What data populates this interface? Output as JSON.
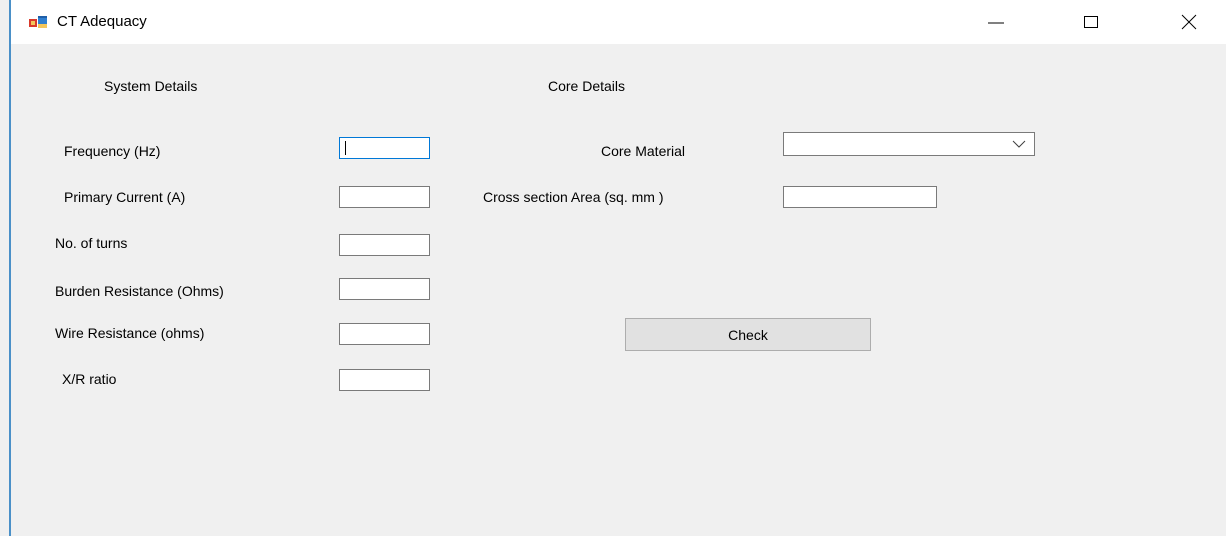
{
  "window": {
    "title": "CT Adequacy",
    "icon": "form-app-icon",
    "controls": {
      "minimize_icon": "minimize-icon",
      "maximize_icon": "maximize-icon",
      "close_icon": "close-icon"
    }
  },
  "system_details": {
    "heading": "System Details",
    "fields": {
      "frequency": {
        "label": "Frequency (Hz)",
        "value": ""
      },
      "primary_current": {
        "label": "Primary Current (A)",
        "value": ""
      },
      "turns": {
        "label": "No. of turns",
        "value": ""
      },
      "burden_resistance": {
        "label": "Burden Resistance (Ohms)",
        "value": ""
      },
      "wire_resistance": {
        "label": "Wire Resistance (ohms)",
        "value": ""
      },
      "xr_ratio": {
        "label": "X/R ratio",
        "value": ""
      }
    }
  },
  "core_details": {
    "heading": "Core Details",
    "core_material": {
      "label": "Core Material",
      "value": ""
    },
    "cross_section": {
      "label": "Cross section Area (sq. mm )",
      "value": ""
    }
  },
  "actions": {
    "check_label": "Check"
  },
  "colors": {
    "window_bg": "#f0f0f0",
    "titlebar_bg": "#ffffff",
    "focus_border": "#0078d7",
    "border_accent": "#4a90c8"
  }
}
